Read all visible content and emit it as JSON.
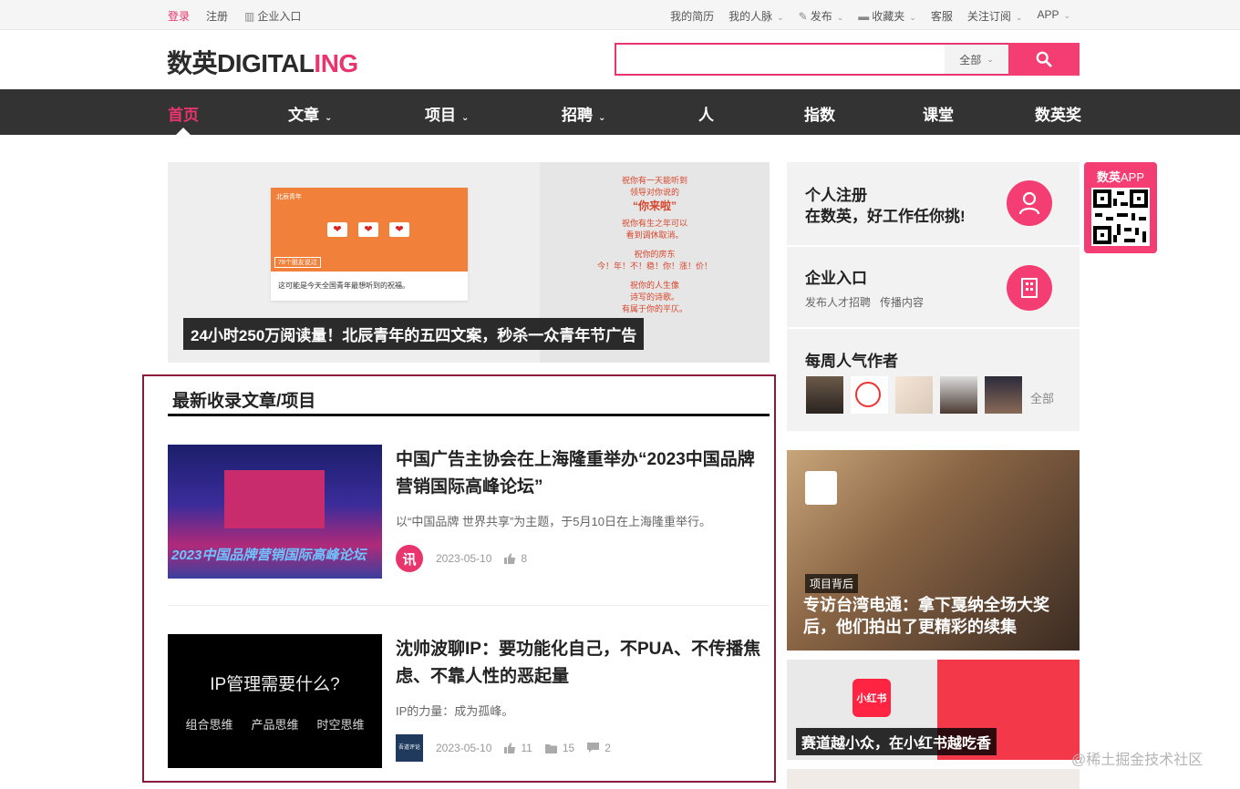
{
  "topbar": {
    "login": "登录",
    "register": "注册",
    "enterprise": "企业入口",
    "resume": "我的简历",
    "network": "我的人脉",
    "publish": "发布",
    "favorites": "收藏夹",
    "service": "客服",
    "subscribe": "关注订阅",
    "app": "APP"
  },
  "logo": {
    "main": "数英DIGITAL",
    "accent": "ING"
  },
  "search": {
    "placeholder": "",
    "scope": "全部"
  },
  "nav": {
    "home": "首页",
    "articles": "文章",
    "projects": "项目",
    "jobs": "招聘",
    "people": "人",
    "index": "指数",
    "classroom": "课堂",
    "awards": "数英奖"
  },
  "hero": {
    "card_caption": "这可能是今天全国青年最想听到的祝福。",
    "card_friends": "78个朋友说过",
    "card_tiny": "北辰青年",
    "poster_lines": [
      "祝你有一天能听到",
      "领导对你说的"
    ],
    "poster_big": "“你来啦”",
    "poster_lines_2": [
      "祝你有生之年可以",
      "看到调休取消。"
    ],
    "poster_lines_3": [
      "祝你的房东",
      "今！年！不！稳！你！涨！价！"
    ],
    "poster_lines_4": [
      "祝你的人生像",
      "诗写的诗歌。",
      "有属于你的平仄。"
    ],
    "title": "24小时250万阅读量！北辰青年的五四文案，秒杀一众青年节广告"
  },
  "latest": {
    "heading": "最新收录文章/项目",
    "articles": [
      {
        "title": "中国广告主协会在上海隆重举办“2023中国品牌营销国际高峰论坛”",
        "desc": "以“中国品牌 世界共享”为主题，于5月10日在上海隆重举行。",
        "author_badge": "讯",
        "date": "2023-05-10",
        "likes": "8",
        "thumb_text": "2023中国品牌营销国际高峰论坛"
      },
      {
        "title": "沈帅波聊IP：要功能化自己，不PUA、不传播焦虑、不靠人性的恶起量",
        "desc": "IP的力量：成为孤峰。",
        "author_badge": "吾道评论",
        "date": "2023-05-10",
        "likes": "11",
        "favorites": "15",
        "comments": "2",
        "thumb_question": "IP管理需要什么?",
        "thumb_keywords": [
          "组合思维",
          "产品思维",
          "时空思维"
        ]
      }
    ]
  },
  "sidebar": {
    "register": {
      "title": "个人注册",
      "subtitle": "在数英，好工作任你挑!"
    },
    "enterprise": {
      "title": "企业入口",
      "sub1": "发布人才招聘",
      "sub2": "传播内容"
    },
    "popular": {
      "title": "每周人气作者",
      "all": "全部"
    },
    "card_a": {
      "tag": "项目背后",
      "title": "专访台湾电通：拿下戛纳全场大奖后，他们拍出了更精彩的续集"
    },
    "card_b": {
      "logo": "小红书",
      "title": "赛道越小众，在小红书越吃香"
    },
    "app": {
      "brand": "数英",
      "label": "APP"
    }
  },
  "watermark": "@稀土掘金技术社区",
  "colors": {
    "accent": "#e8356d",
    "nav_bg": "#333333"
  }
}
